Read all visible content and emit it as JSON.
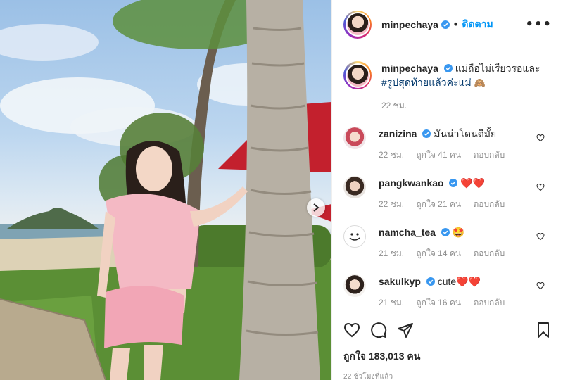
{
  "post": {
    "username": "minpechaya",
    "separator": "•",
    "follow_label": "ติดตาม",
    "more_icon": "more-options-icon",
    "more_label": "•••"
  },
  "caption": {
    "username": "minpechaya",
    "text": "แม่ถือไม่เรียวรอและ",
    "hashtag": "#รูปสุดท้ายแล้วค่ะแม่",
    "emoji": "🙈",
    "time": "22 ชม."
  },
  "comments": [
    {
      "username": "zanizina",
      "text": "มันน่าโดนตีมั้ย",
      "time": "22 ชม.",
      "likes": "ถูกใจ 41 คน",
      "reply": "ตอบกลับ"
    },
    {
      "username": "pangkwankao",
      "text": "❤️❤️",
      "time": "22 ชม.",
      "likes": "ถูกใจ 21 คน",
      "reply": "ตอบกลับ"
    },
    {
      "username": "namcha_tea",
      "text": "🤩",
      "time": "21 ชม.",
      "likes": "ถูกใจ 14 คน",
      "reply": "ตอบกลับ"
    },
    {
      "username": "sakulkyp",
      "text": "cute❤️❤️",
      "time": "21 ชม.",
      "likes": "ถูกใจ 16 คน",
      "reply": "ตอบกลับ"
    }
  ],
  "footer": {
    "likes": "ถูกใจ 183,013 คน",
    "timestamp": "22 ชั่วโมงที่แล้ว"
  },
  "colors": {
    "follow": "#0095f6",
    "verified": "#3897f0",
    "muted": "#8e8e8e",
    "border": "#efefef",
    "like_red": "#ed4956"
  }
}
